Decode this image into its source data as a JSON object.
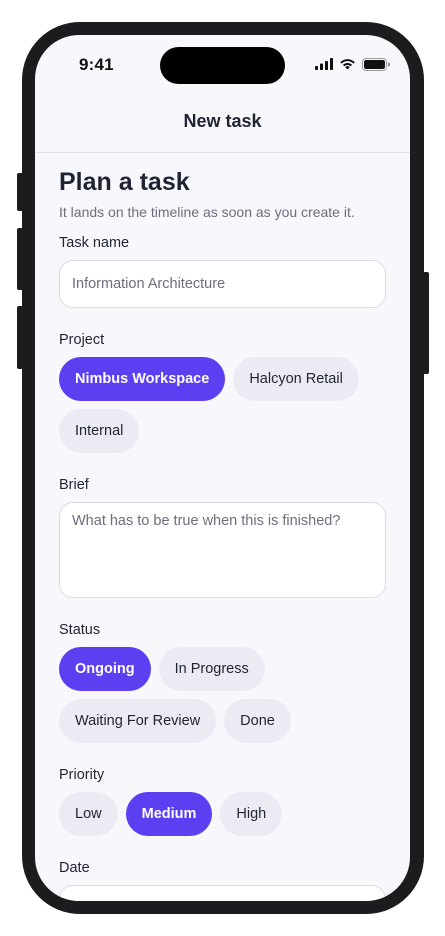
{
  "status_bar": {
    "time": "9:41"
  },
  "nav": {
    "title": "New task"
  },
  "form": {
    "heading": "Plan a task",
    "subheading": "It lands on the timeline as soon as you create it.",
    "task_name": {
      "label": "Task name",
      "placeholder": "Information Architecture",
      "value": ""
    },
    "project": {
      "label": "Project",
      "options": [
        "Nimbus Workspace",
        "Halcyon Retail",
        "Internal"
      ],
      "selected": "Nimbus Workspace"
    },
    "brief": {
      "label": "Brief",
      "placeholder": "What has to be true when this is finished?",
      "value": ""
    },
    "status": {
      "label": "Status",
      "options": [
        "Ongoing",
        "In Progress",
        "Waiting For Review",
        "Done"
      ],
      "selected": "Ongoing"
    },
    "priority": {
      "label": "Priority",
      "options": [
        "Low",
        "Medium",
        "High"
      ],
      "selected": "Medium"
    },
    "date": {
      "label": "Date"
    }
  },
  "colors": {
    "accent": "#5b3ff0",
    "chip_bg": "#ecebf4",
    "screen_bg": "#f8f7fc",
    "text": "#1f2433",
    "muted": "#6b6f7d"
  }
}
